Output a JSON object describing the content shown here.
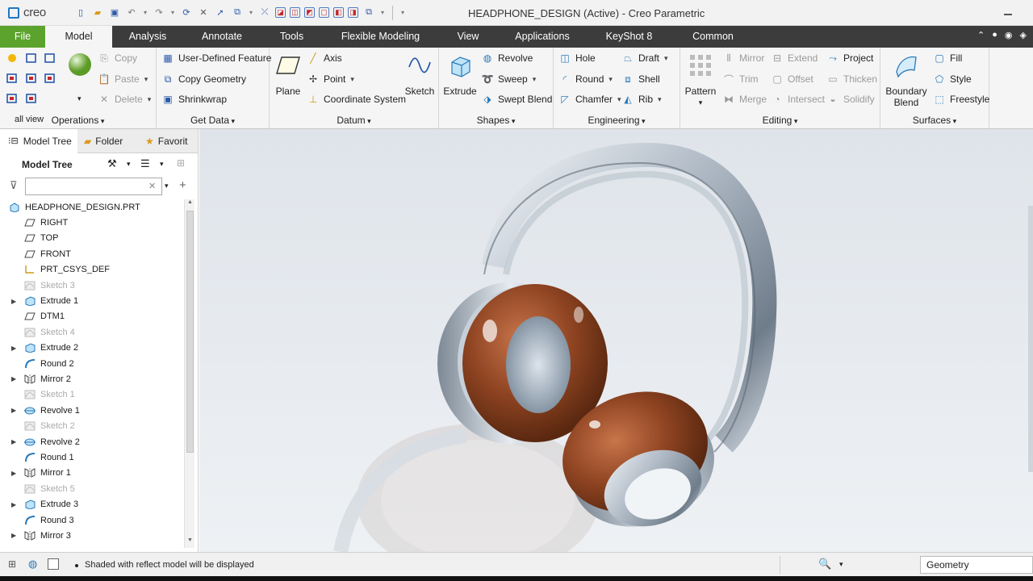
{
  "app": {
    "logo": "creo",
    "window_title": "HEADPHONE_DESIGN (Active) - Creo Parametric"
  },
  "tabs": [
    "File",
    "Model",
    "Analysis",
    "Annotate",
    "Tools",
    "Flexible Modeling",
    "View",
    "Applications",
    "KeyShot 8",
    "Common"
  ],
  "active_tab": "Model",
  "ribbon": {
    "operations": {
      "label": "Operations",
      "all_view": "all view",
      "copy": "Copy",
      "paste": "Paste",
      "delete": "Delete"
    },
    "getdata": {
      "label": "Get Data",
      "udf": "User-Defined Feature",
      "copy_geometry": "Copy Geometry",
      "shrinkwrap": "Shrinkwrap"
    },
    "datum": {
      "label": "Datum",
      "plane": "Plane",
      "axis": "Axis",
      "point": "Point",
      "csys": "Coordinate System",
      "sketch": "Sketch"
    },
    "shapes": {
      "label": "Shapes",
      "extrude": "Extrude",
      "revolve": "Revolve",
      "sweep": "Sweep",
      "swept_blend": "Swept Blend"
    },
    "engineering": {
      "label": "Engineering",
      "hole": "Hole",
      "round": "Round",
      "chamfer": "Chamfer",
      "draft": "Draft",
      "shell": "Shell",
      "rib": "Rib"
    },
    "editing": {
      "label": "Editing",
      "pattern": "Pattern",
      "mirror": "Mirror",
      "trim": "Trim",
      "merge": "Merge",
      "extend": "Extend",
      "offset": "Offset",
      "intersect": "Intersect",
      "project": "Project",
      "thicken": "Thicken",
      "solidify": "Solidify"
    },
    "surfaces": {
      "label": "Surfaces",
      "boundary_blend_1": "Boundary",
      "boundary_blend_2": "Blend",
      "fill": "Fill",
      "style": "Style",
      "freestyle": "Freestyle"
    }
  },
  "panel": {
    "tabs": [
      "Model Tree",
      "Folder",
      "Favorit"
    ],
    "heading": "Model Tree",
    "search_value": "",
    "tree": [
      {
        "label": "HEADPHONE_DESIGN.PRT",
        "icon": "part-icon",
        "exp": false,
        "dim": false
      },
      {
        "label": "RIGHT",
        "icon": "plane-icon",
        "exp": false,
        "dim": false
      },
      {
        "label": "TOP",
        "icon": "plane-icon",
        "exp": false,
        "dim": false
      },
      {
        "label": "FRONT",
        "icon": "plane-icon",
        "exp": false,
        "dim": false
      },
      {
        "label": "PRT_CSYS_DEF",
        "icon": "csys-icon",
        "exp": false,
        "dim": false
      },
      {
        "label": "Sketch 3",
        "icon": "sketch-icon",
        "exp": false,
        "dim": true
      },
      {
        "label": "Extrude 1",
        "icon": "extrude-icon",
        "exp": true,
        "dim": false
      },
      {
        "label": "DTM1",
        "icon": "plane-icon",
        "exp": false,
        "dim": false
      },
      {
        "label": "Sketch 4",
        "icon": "sketch-icon",
        "exp": false,
        "dim": true
      },
      {
        "label": "Extrude 2",
        "icon": "extrude-icon",
        "exp": true,
        "dim": false
      },
      {
        "label": "Round 2",
        "icon": "round-icon",
        "exp": false,
        "dim": false
      },
      {
        "label": "Mirror 2",
        "icon": "mirror-icon",
        "exp": true,
        "dim": false
      },
      {
        "label": "Sketch 1",
        "icon": "sketch-icon",
        "exp": false,
        "dim": true
      },
      {
        "label": "Revolve 1",
        "icon": "revolve-icon",
        "exp": true,
        "dim": false
      },
      {
        "label": "Sketch 2",
        "icon": "sketch-icon",
        "exp": false,
        "dim": true
      },
      {
        "label": "Revolve 2",
        "icon": "revolve-icon",
        "exp": true,
        "dim": false
      },
      {
        "label": "Round 1",
        "icon": "round-icon",
        "exp": false,
        "dim": false
      },
      {
        "label": "Mirror 1",
        "icon": "mirror-icon",
        "exp": true,
        "dim": false
      },
      {
        "label": "Sketch 5",
        "icon": "sketch-icon",
        "exp": false,
        "dim": true
      },
      {
        "label": "Extrude 3",
        "icon": "extrude-icon",
        "exp": true,
        "dim": false
      },
      {
        "label": "Round 3",
        "icon": "round-icon",
        "exp": false,
        "dim": false
      },
      {
        "label": "Mirror 3",
        "icon": "mirror-icon",
        "exp": true,
        "dim": false
      }
    ]
  },
  "status": {
    "message": "Shaded with reflect model will be displayed",
    "filter_value": "Geometry"
  },
  "colors": {
    "accent_green": "#5ba32c",
    "tab_bar": "#3c3c3c",
    "brand_blue": "#1d77c7",
    "earpad": "#8a3f1c"
  }
}
